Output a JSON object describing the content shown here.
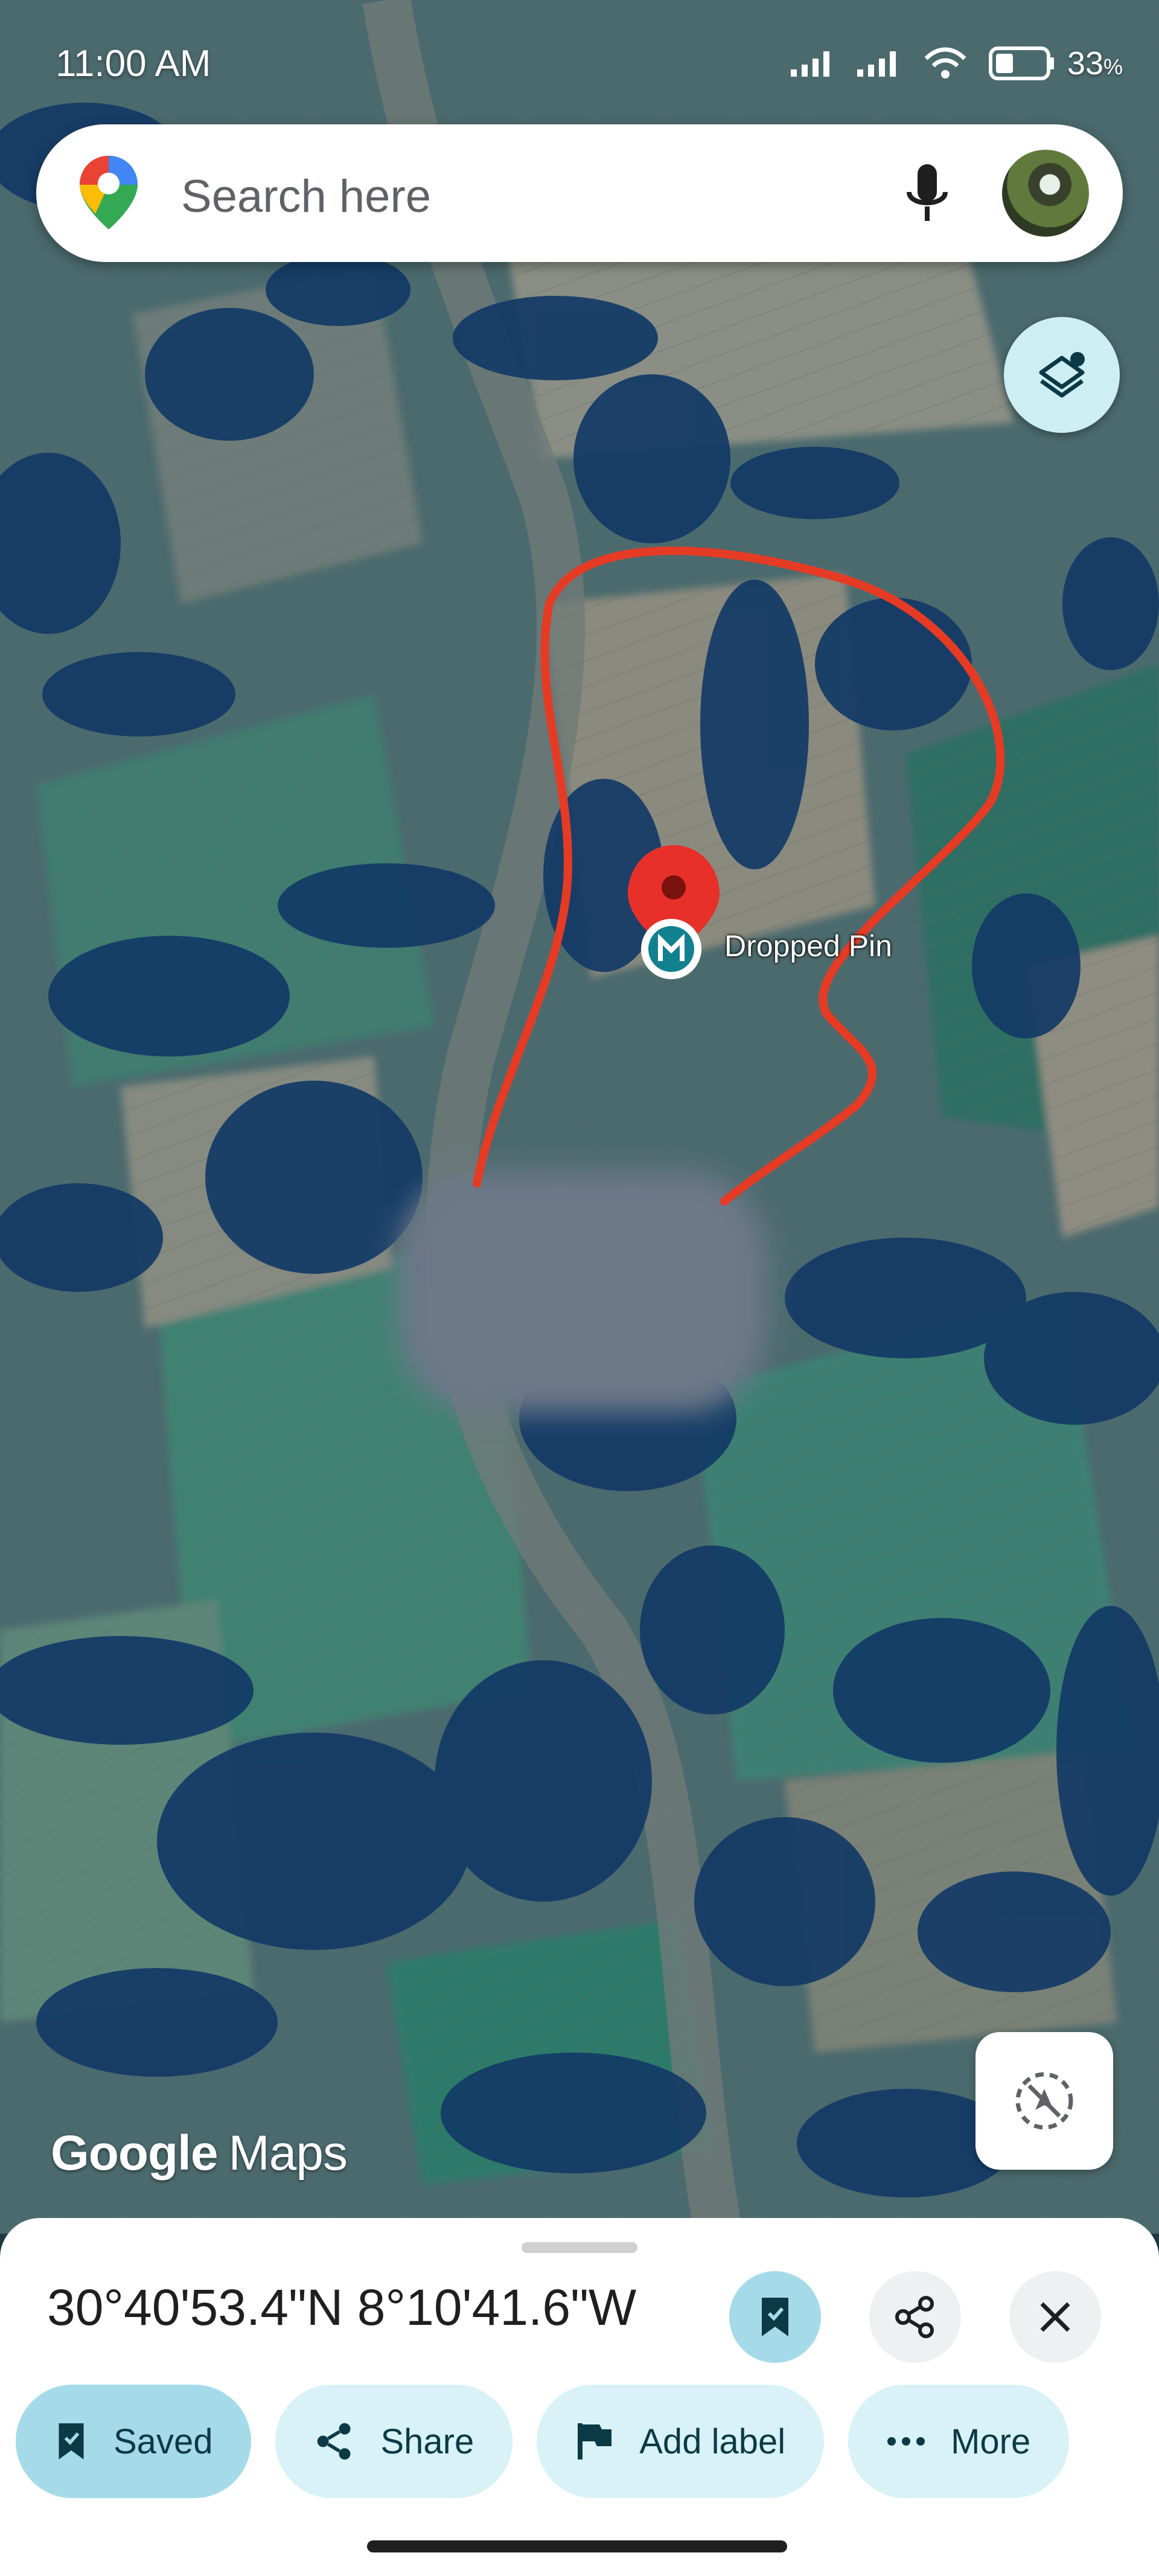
{
  "status_bar": {
    "time": "11:00 AM",
    "battery_percent": "33",
    "battery_suffix": "%"
  },
  "search": {
    "placeholder": "Search here"
  },
  "map": {
    "pin_label": "Dropped Pin",
    "attribution_brand": "Google",
    "attribution_product": "Maps"
  },
  "sheet": {
    "coordinates": "30°40'53.4\"N 8°10'41.6\"W",
    "chips": [
      {
        "label": "Saved",
        "icon": "bookmark-icon"
      },
      {
        "label": "Share",
        "icon": "share-icon"
      },
      {
        "label": "Add label",
        "icon": "flag-icon"
      },
      {
        "label": "More",
        "icon": "more-dots-icon"
      }
    ]
  },
  "colors": {
    "accent": "#a5dbe8",
    "chip_bg": "#d8f2f7",
    "route_line": "#e53b25",
    "pin": "#e8302a"
  }
}
